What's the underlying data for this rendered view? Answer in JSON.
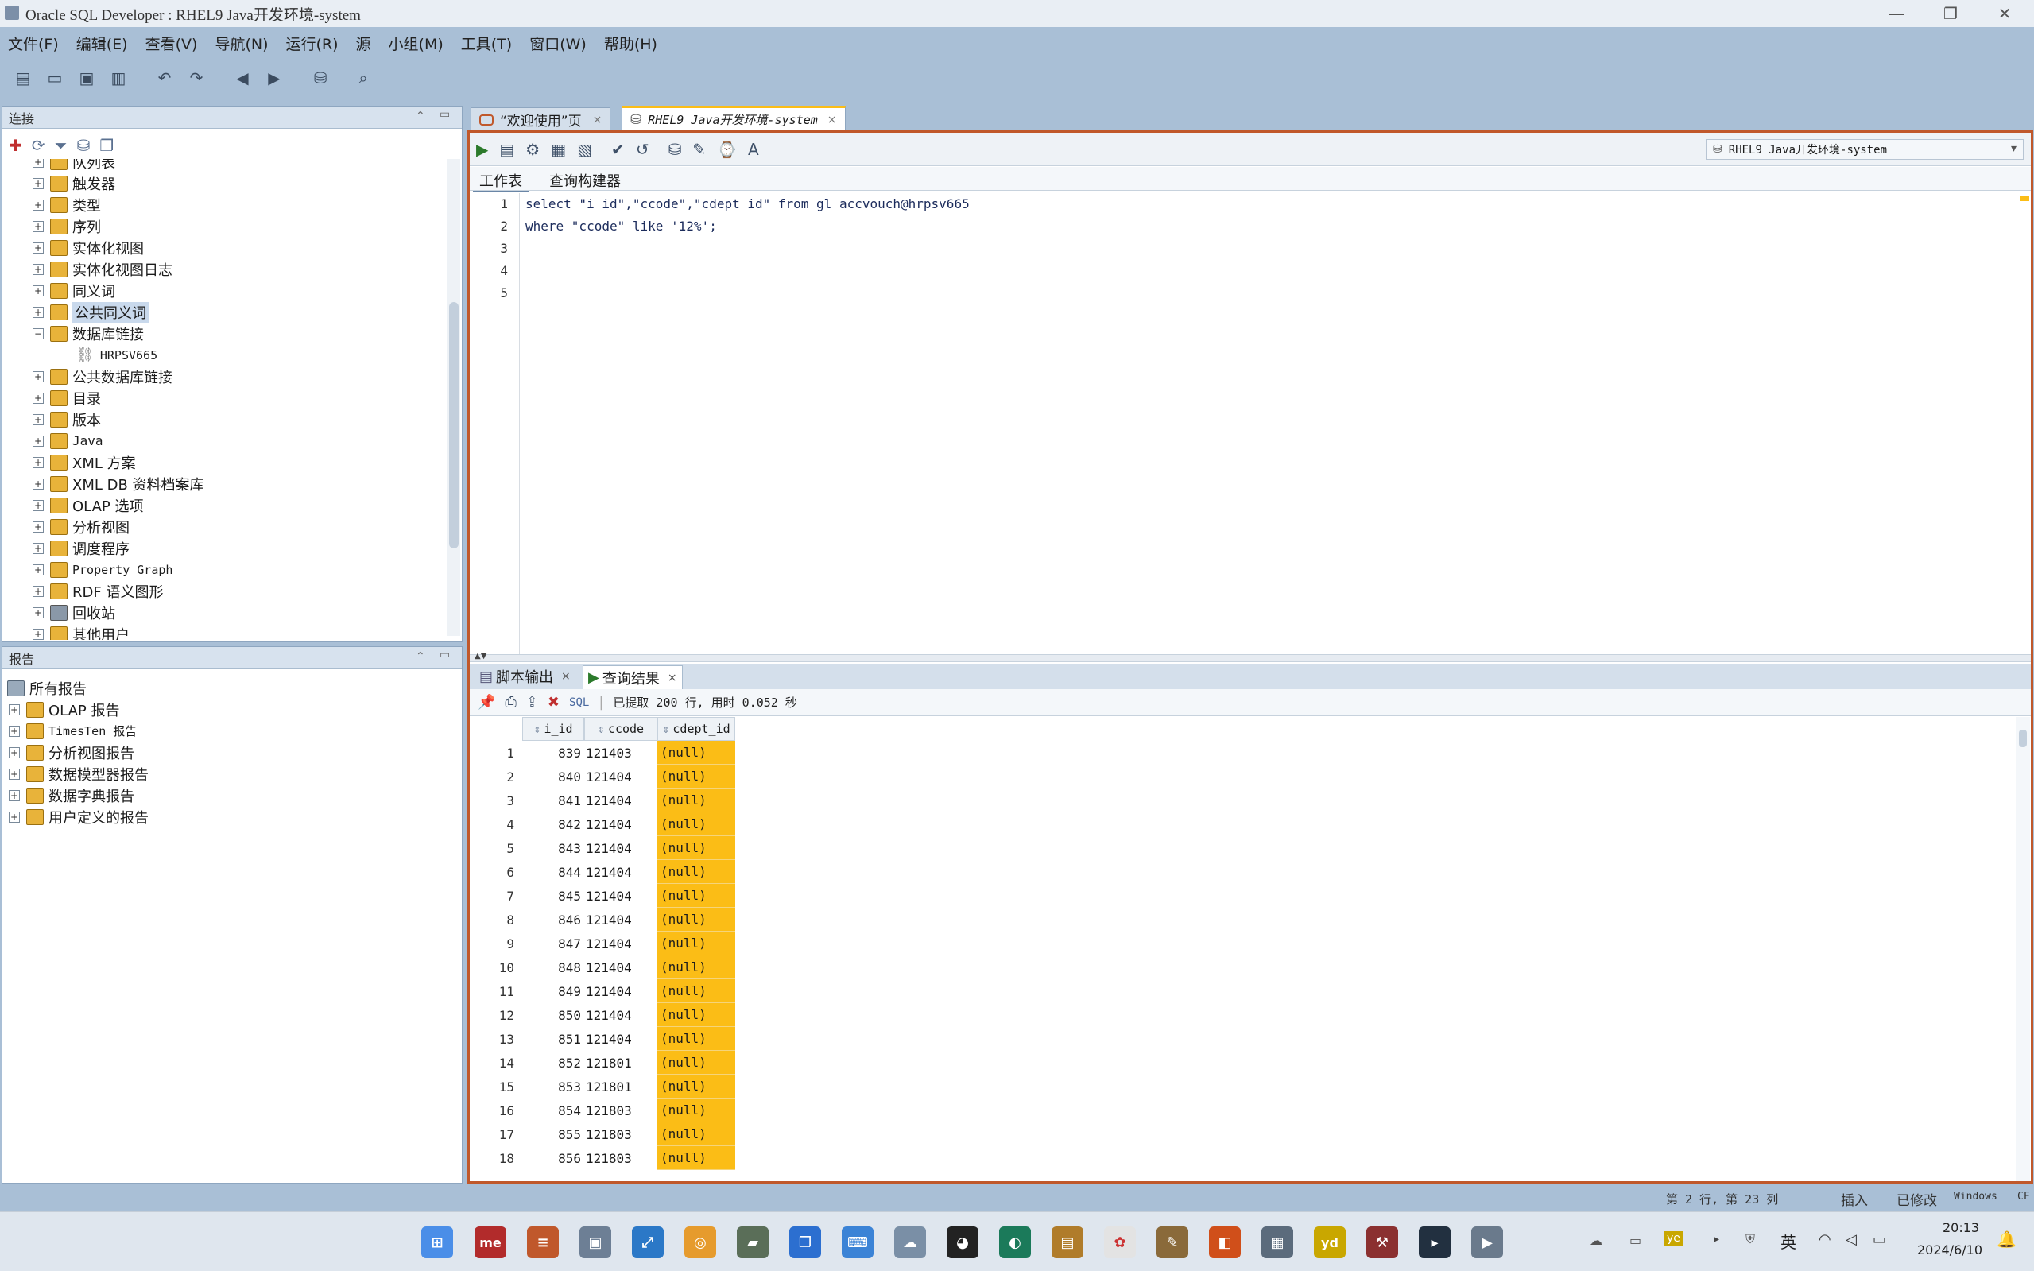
{
  "window": {
    "title": "Oracle SQL Developer : RHEL9 Java开发环境-system",
    "minimize": "—",
    "maximize": "❐",
    "close": "✕"
  },
  "menu": [
    "文件(F)",
    "编辑(E)",
    "查看(V)",
    "导航(N)",
    "运行(R)",
    "源",
    "小组(M)",
    "工具(T)",
    "窗口(W)",
    "帮助(H)"
  ],
  "connections_panel": {
    "title": "连接",
    "tree": [
      {
        "label": "队列表",
        "expanded": false
      },
      {
        "label": "触发器",
        "expanded": false
      },
      {
        "label": "类型",
        "expanded": false
      },
      {
        "label": "序列",
        "expanded": false
      },
      {
        "label": "实体化视图",
        "expanded": false
      },
      {
        "label": "实体化视图日志",
        "expanded": false
      },
      {
        "label": "同义词",
        "expanded": false
      },
      {
        "label": "公共同义词",
        "expanded": false,
        "selected": true
      },
      {
        "label": "数据库链接",
        "expanded": true
      },
      {
        "label": "HRPSV665",
        "child": true
      },
      {
        "label": "公共数据库链接",
        "expanded": false
      },
      {
        "label": "目录",
        "expanded": false
      },
      {
        "label": "版本",
        "expanded": false
      },
      {
        "label": "Java",
        "expanded": false
      },
      {
        "label": "XML 方案",
        "expanded": false
      },
      {
        "label": "XML DB 资料档案库",
        "expanded": false
      },
      {
        "label": "OLAP 选项",
        "expanded": false
      },
      {
        "label": "分析视图",
        "expanded": false
      },
      {
        "label": "调度程序",
        "expanded": false
      },
      {
        "label": "Property Graph",
        "expanded": false
      },
      {
        "label": "RDF 语义图形",
        "expanded": false
      },
      {
        "label": "回收站",
        "expanded": false
      },
      {
        "label": "其他用户",
        "expanded": false
      }
    ]
  },
  "reports_panel": {
    "title": "报告",
    "root": "所有报告",
    "items": [
      "OLAP 报告",
      "TimesTen 报告",
      "分析视图报告",
      "数据模型器报告",
      "数据字典报告",
      "用户定义的报告"
    ]
  },
  "editor_tabs": [
    {
      "label": "“欢迎使用”页"
    },
    {
      "label": "RHEL9 Java开发环境-system",
      "active": true
    }
  ],
  "connection_selector": "RHEL9 Java开发环境-system",
  "sub_tabs": [
    "工作表",
    "查询构建器"
  ],
  "sql_lines": [
    {
      "n": "1",
      "text": "select \"i_id\",\"ccode\",\"cdept_id\" from gl_accvouch@hrpsv665"
    },
    {
      "n": "2",
      "text": "where \"ccode\" like '12%';"
    },
    {
      "n": "3",
      "text": ""
    },
    {
      "n": "4",
      "text": ""
    },
    {
      "n": "5",
      "text": ""
    }
  ],
  "result_tabs": [
    "脚本输出",
    "查询结果"
  ],
  "result_status": {
    "sql_label": "SQL",
    "message": "已提取 200 行, 用时 0.052 秒"
  },
  "grid": {
    "columns": [
      "i_id",
      "ccode",
      "cdept_id"
    ],
    "rows": [
      [
        "1",
        "839",
        "121403",
        "(null)"
      ],
      [
        "2",
        "840",
        "121404",
        "(null)"
      ],
      [
        "3",
        "841",
        "121404",
        "(null)"
      ],
      [
        "4",
        "842",
        "121404",
        "(null)"
      ],
      [
        "5",
        "843",
        "121404",
        "(null)"
      ],
      [
        "6",
        "844",
        "121404",
        "(null)"
      ],
      [
        "7",
        "845",
        "121404",
        "(null)"
      ],
      [
        "8",
        "846",
        "121404",
        "(null)"
      ],
      [
        "9",
        "847",
        "121404",
        "(null)"
      ],
      [
        "10",
        "848",
        "121404",
        "(null)"
      ],
      [
        "11",
        "849",
        "121404",
        "(null)"
      ],
      [
        "12",
        "850",
        "121404",
        "(null)"
      ],
      [
        "13",
        "851",
        "121404",
        "(null)"
      ],
      [
        "14",
        "852",
        "121801",
        "(null)"
      ],
      [
        "15",
        "853",
        "121801",
        "(null)"
      ],
      [
        "16",
        "854",
        "121803",
        "(null)"
      ],
      [
        "17",
        "855",
        "121803",
        "(null)"
      ],
      [
        "18",
        "856",
        "121803",
        "(null)"
      ]
    ]
  },
  "statusbar": {
    "pos": "第 2 行, 第 23 列",
    "mode": "插入",
    "modified": "已修改",
    "os": "Windows",
    "enc": "CF"
  },
  "taskbar": {
    "ime": "英",
    "time": "20:13",
    "date": "2024/6/10",
    "app_me": "me",
    "app_yd": "yd"
  },
  "colors": {
    "accent": "#c0582b",
    "highlight": "#fbbd16",
    "chrome": "#a9bfd6"
  }
}
